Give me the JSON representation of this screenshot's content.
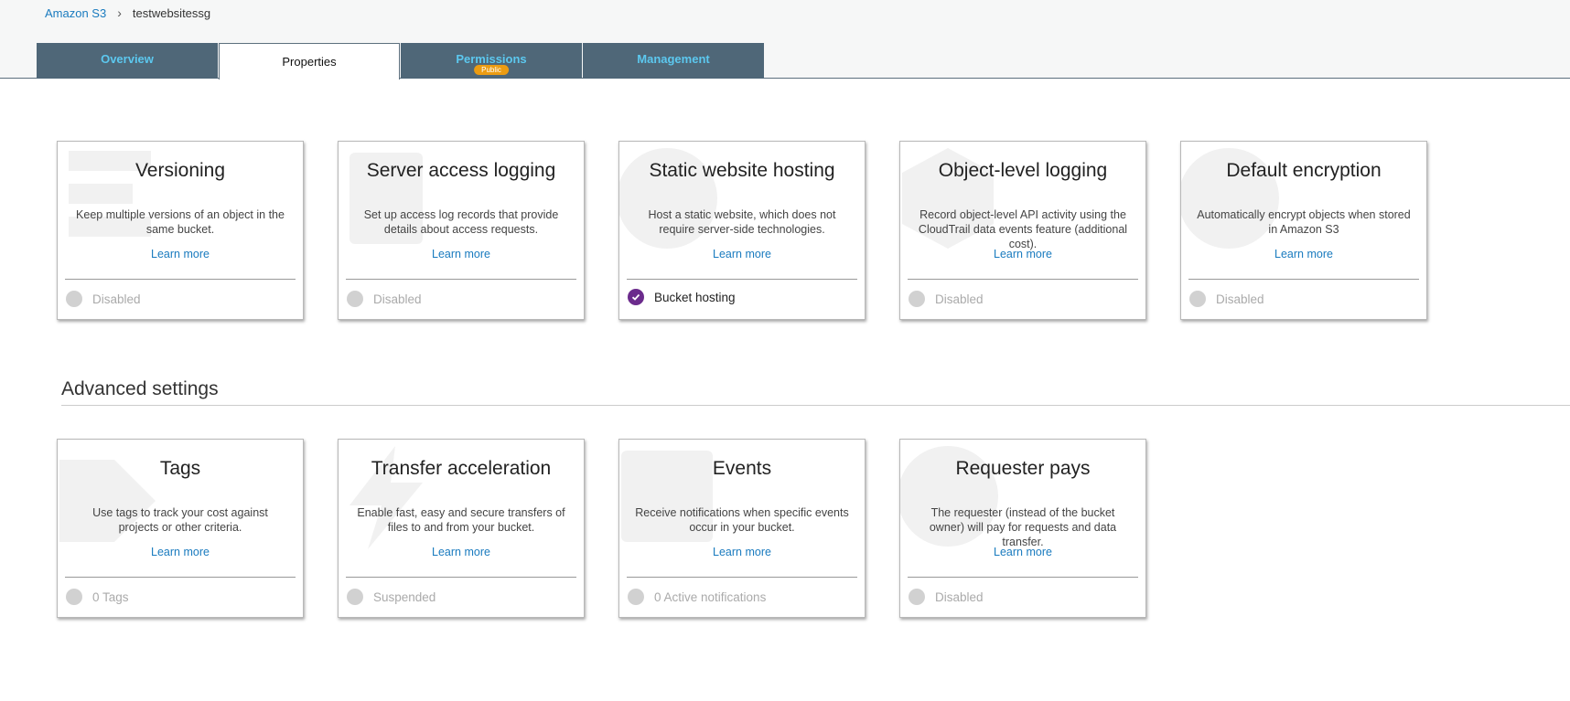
{
  "breadcrumb": {
    "root": "Amazon S3",
    "separator": "›",
    "current": "testwebsitessg"
  },
  "tabs": [
    {
      "label": "Overview"
    },
    {
      "label": "Properties"
    },
    {
      "label": "Permissions",
      "badge": "Public"
    },
    {
      "label": "Management"
    }
  ],
  "properties": [
    {
      "title": "Versioning",
      "description": "Keep multiple versions of an object in the same bucket.",
      "learn_more": "Learn more",
      "status": "Disabled"
    },
    {
      "title": "Server access logging",
      "description": "Set up access log records that provide details about access requests.",
      "learn_more": "Learn more",
      "status": "Disabled"
    },
    {
      "title": "Static website hosting",
      "description": "Host a static website, which does not require server-side technologies.",
      "learn_more": "Learn more",
      "status": "Bucket hosting"
    },
    {
      "title": "Object-level logging",
      "description": "Record object-level API activity using the CloudTrail data events feature (additional cost).",
      "learn_more": "Learn more",
      "status": "Disabled"
    },
    {
      "title": "Default encryption",
      "description": "Automatically encrypt objects when stored in Amazon S3",
      "learn_more": "Learn more",
      "status": "Disabled"
    }
  ],
  "advanced": {
    "heading": "Advanced settings",
    "cards": [
      {
        "title": "Tags",
        "description": "Use tags to track your cost against projects or other criteria.",
        "learn_more": "Learn more",
        "status": "0 Tags"
      },
      {
        "title": "Transfer acceleration",
        "description": "Enable fast, easy and secure transfers of files to and from your bucket.",
        "learn_more": "Learn more",
        "status": "Suspended"
      },
      {
        "title": "Events",
        "description": "Receive notifications when specific events occur in your bucket.",
        "learn_more": "Learn more",
        "status": "0 Active notifications"
      },
      {
        "title": "Requester pays",
        "description": "The requester (instead of the bucket owner) will pay for requests and data transfer.",
        "learn_more": "Learn more",
        "status": "Disabled"
      }
    ]
  },
  "colors": {
    "tab_bg": "#4f6778",
    "tab_text": "#5cc8ef",
    "badge": "#ec9c12",
    "link": "#1a7bbf",
    "enabled_check": "#6b2b8c"
  }
}
